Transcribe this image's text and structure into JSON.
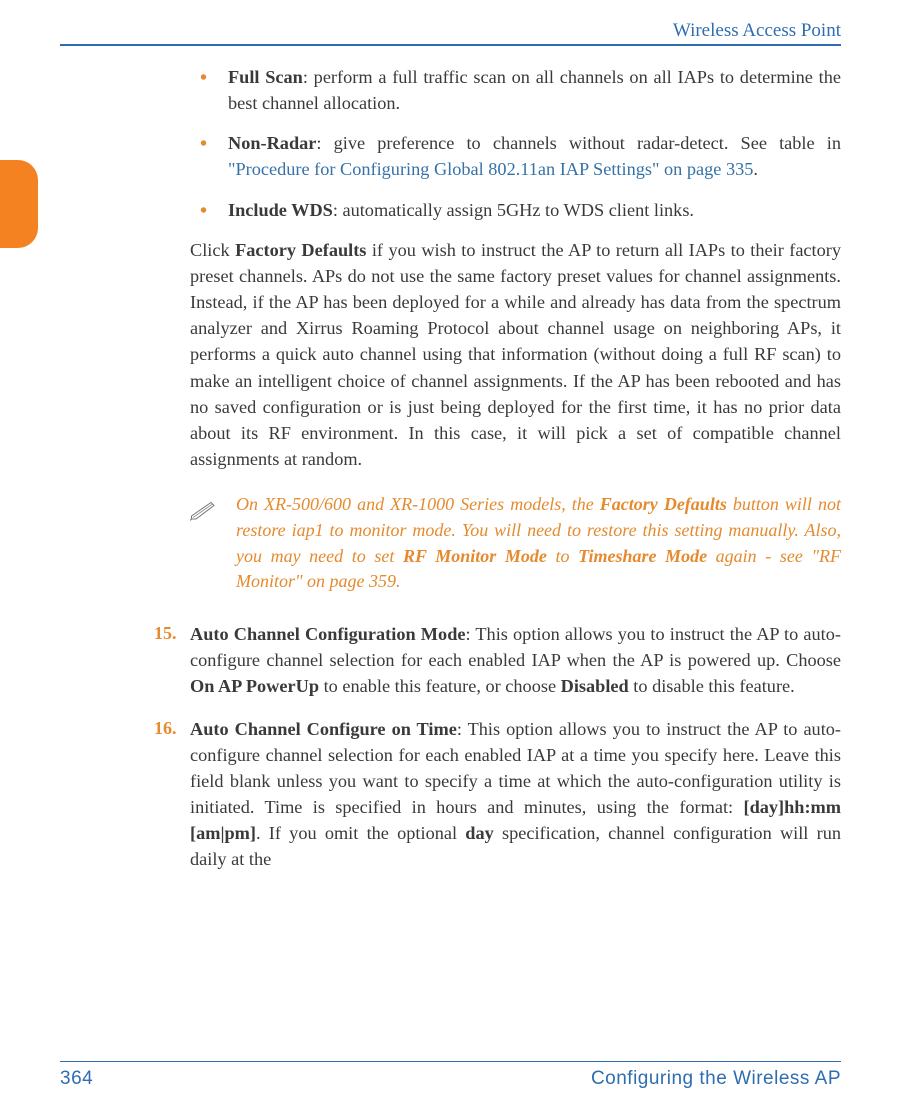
{
  "header": {
    "title": "Wireless Access Point"
  },
  "bullets": {
    "b1_bold": "Full Scan",
    "b1_text": ": perform a full traffic scan on all channels on all IAPs to determine the best channel allocation.",
    "b2_bold": "Non-Radar",
    "b2_text1": ": give preference to channels without radar-detect. See table in ",
    "b2_link": "\"Procedure for Configuring Global 802.11an IAP Settings\" on page 335",
    "b2_text2": ".",
    "b3_bold": "Include WDS",
    "b3_text": ": automatically assign 5GHz to WDS client links."
  },
  "para1": {
    "t1": "Click ",
    "b1": "Factory Defaults",
    "t2": " if you wish to instruct the AP to return all IAPs to their factory preset channels. APs do not use the same factory preset values for channel assignments. Instead, if the AP has been deployed for a while and already has data from the spectrum analyzer and Xirrus Roaming Protocol about channel usage on neighboring APs, it performs a quick auto channel using that information (without doing a full RF scan) to make an intelligent choice of channel assignments. If the AP has been rebooted and has no saved configuration or is just being deployed for the first time, it has no prior data about its RF environment. In this case, it will pick a set of compatible channel assignments at random."
  },
  "note": {
    "t1": "On XR-500/600 and XR-1000 Series models, the ",
    "b1": "Factory Defaults",
    "t2": " button will not restore iap1 to monitor mode. You will need to restore this setting manually. Also, you may need to set ",
    "b2": "RF Monitor Mode",
    "t3": " to ",
    "b3": "Timeshare Mode",
    "t4": " again - see \"RF Monitor\" on page 359."
  },
  "item15": {
    "num": "15.",
    "b1": "Auto Channel Configuration Mode",
    "t1": ": This option allows you to instruct the AP to auto-configure channel selection for each enabled IAP when the AP is powered up. Choose ",
    "b2": "On AP PowerUp",
    "t2": " to enable this feature, or choose ",
    "b3": "Disabled",
    "t3": " to disable this feature."
  },
  "item16": {
    "num": "16.",
    "b1": "Auto Channel Configure on Time",
    "t1": ": This option allows you to instruct the AP to auto-configure channel selection for each enabled IAP at a time you specify here. Leave this field blank unless you want to specify a time at which the auto-configuration utility is initiated. Time is specified in hours and minutes, using the format: ",
    "b2": "[day]hh:mm [am|pm]",
    "t2": ". If you omit the optional ",
    "b3": "day",
    "t3": " specification, channel configuration will run daily at the"
  },
  "footer": {
    "page": "364",
    "section": "Configuring the Wireless AP"
  }
}
